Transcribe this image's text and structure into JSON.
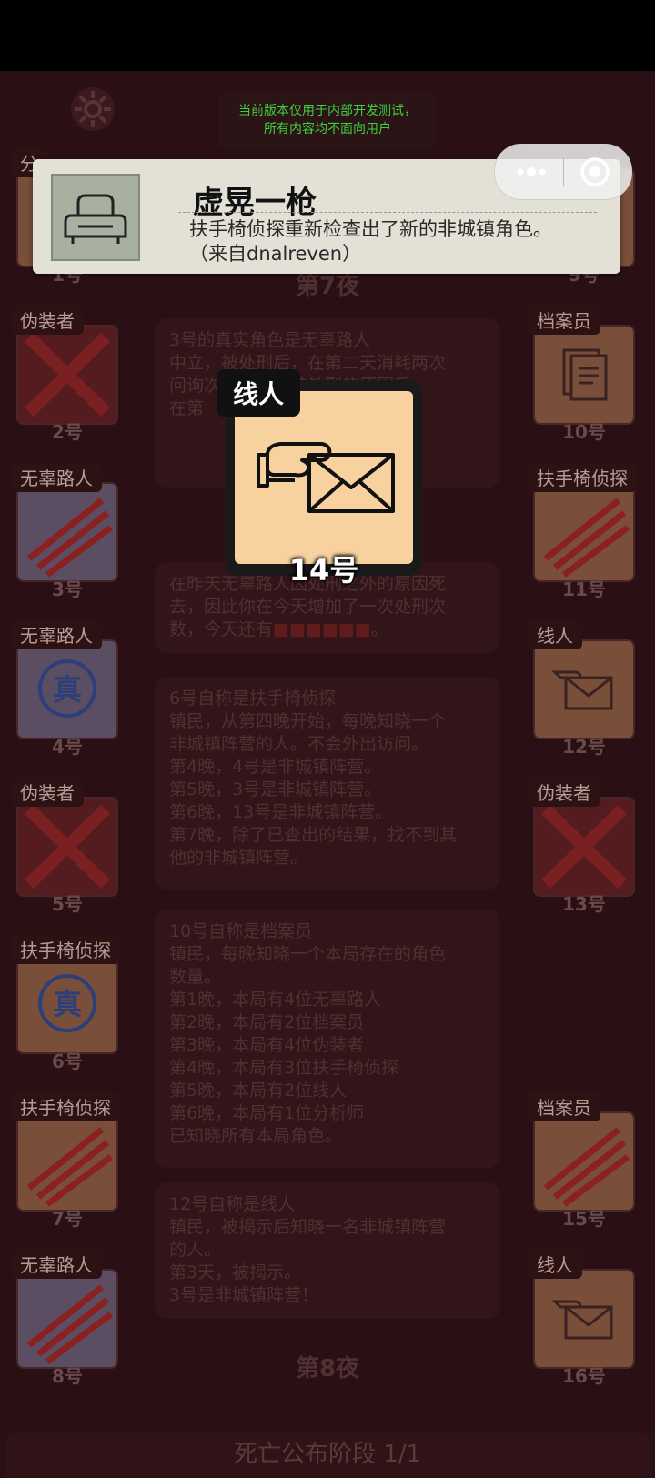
{
  "notice": {
    "line1": "当前版本仅用于内部开发测试，",
    "line2": "所有内容均不面向用户"
  },
  "toast": {
    "title": "虚晃一枪",
    "message_line1": "扶手椅侦探重新检查出了新的非城镇角色。",
    "message_line2": "（来自dnalreven）",
    "icon": "armchair-icon"
  },
  "popup": {
    "role": "线人",
    "number": "14号",
    "icon": "envelope-hand-icon"
  },
  "nights": {
    "n7": "第7夜",
    "n8": "第8夜"
  },
  "left_cards": [
    {
      "role": "分",
      "number": "1号"
    },
    {
      "role": "伪装者",
      "number": "2号"
    },
    {
      "role": "无辜路人",
      "number": "3号"
    },
    {
      "role": "无辜路人",
      "number": "4号"
    },
    {
      "role": "伪装者",
      "number": "5号"
    },
    {
      "role": "扶手椅侦探",
      "number": "6号"
    },
    {
      "role": "扶手椅侦探",
      "number": "7号"
    },
    {
      "role": "无辜路人",
      "number": "8号"
    }
  ],
  "right_cards": [
    {
      "role": "",
      "number": "9号"
    },
    {
      "role": "档案员",
      "number": "10号"
    },
    {
      "role": "扶手椅侦探",
      "number": "11号"
    },
    {
      "role": "线人",
      "number": "12号"
    },
    {
      "role": "伪装者",
      "number": "13号"
    },
    {
      "role": "档案员",
      "number": "15号"
    },
    {
      "role": "线人",
      "number": "16号"
    }
  ],
  "true_badge": "真",
  "panels": {
    "p1": [
      "3号的真实角色是无辜路人",
      "中立，被处刑后，在第二天消耗两次",
      "问询次数。因为被处刑的原因后，",
      "在第"
    ],
    "p2": [
      "在昨天无辜路人因处刑之外的原因死",
      "去，因此你在今天增加了一次处刑次",
      "数，今天还有",
      "。"
    ],
    "p3": [
      "6号自称是扶手椅侦探",
      "镇民，从第四晚开始，每晚知晓一个",
      "非城镇阵营的人。不会外出访问。",
      "第4晚，4号是非城镇阵营。",
      "第5晚，3号是非城镇阵营。",
      "第6晚，13号是非城镇阵营。",
      "第7晚，除了已查出的结果，找不到其",
      "他的非城镇阵营。"
    ],
    "p4": [
      "10号自称是档案员",
      "镇民，每晚知晓一个本局存在的角色",
      "数量。",
      "第1晚，本局有4位无辜路人",
      "第2晚，本局有2位档案员",
      "第3晚，本局有4位伪装者",
      "第4晚，本局有3位扶手椅侦探",
      "第5晚，本局有2位线人",
      "第6晚，本局有1位分析师",
      "已知晓所有本局角色。"
    ],
    "p5": [
      "12号自称是线人",
      "镇民，被揭示后知晓一名非城镇阵营",
      "的人。",
      "第3天，被揭示。",
      "3号是非城镇阵营！"
    ]
  },
  "phase": "死亡公布阶段 1/1",
  "colors": {
    "popup_card": "#f8d29e",
    "notice_text": "#3fcf3f",
    "slash": "#8b2020"
  }
}
